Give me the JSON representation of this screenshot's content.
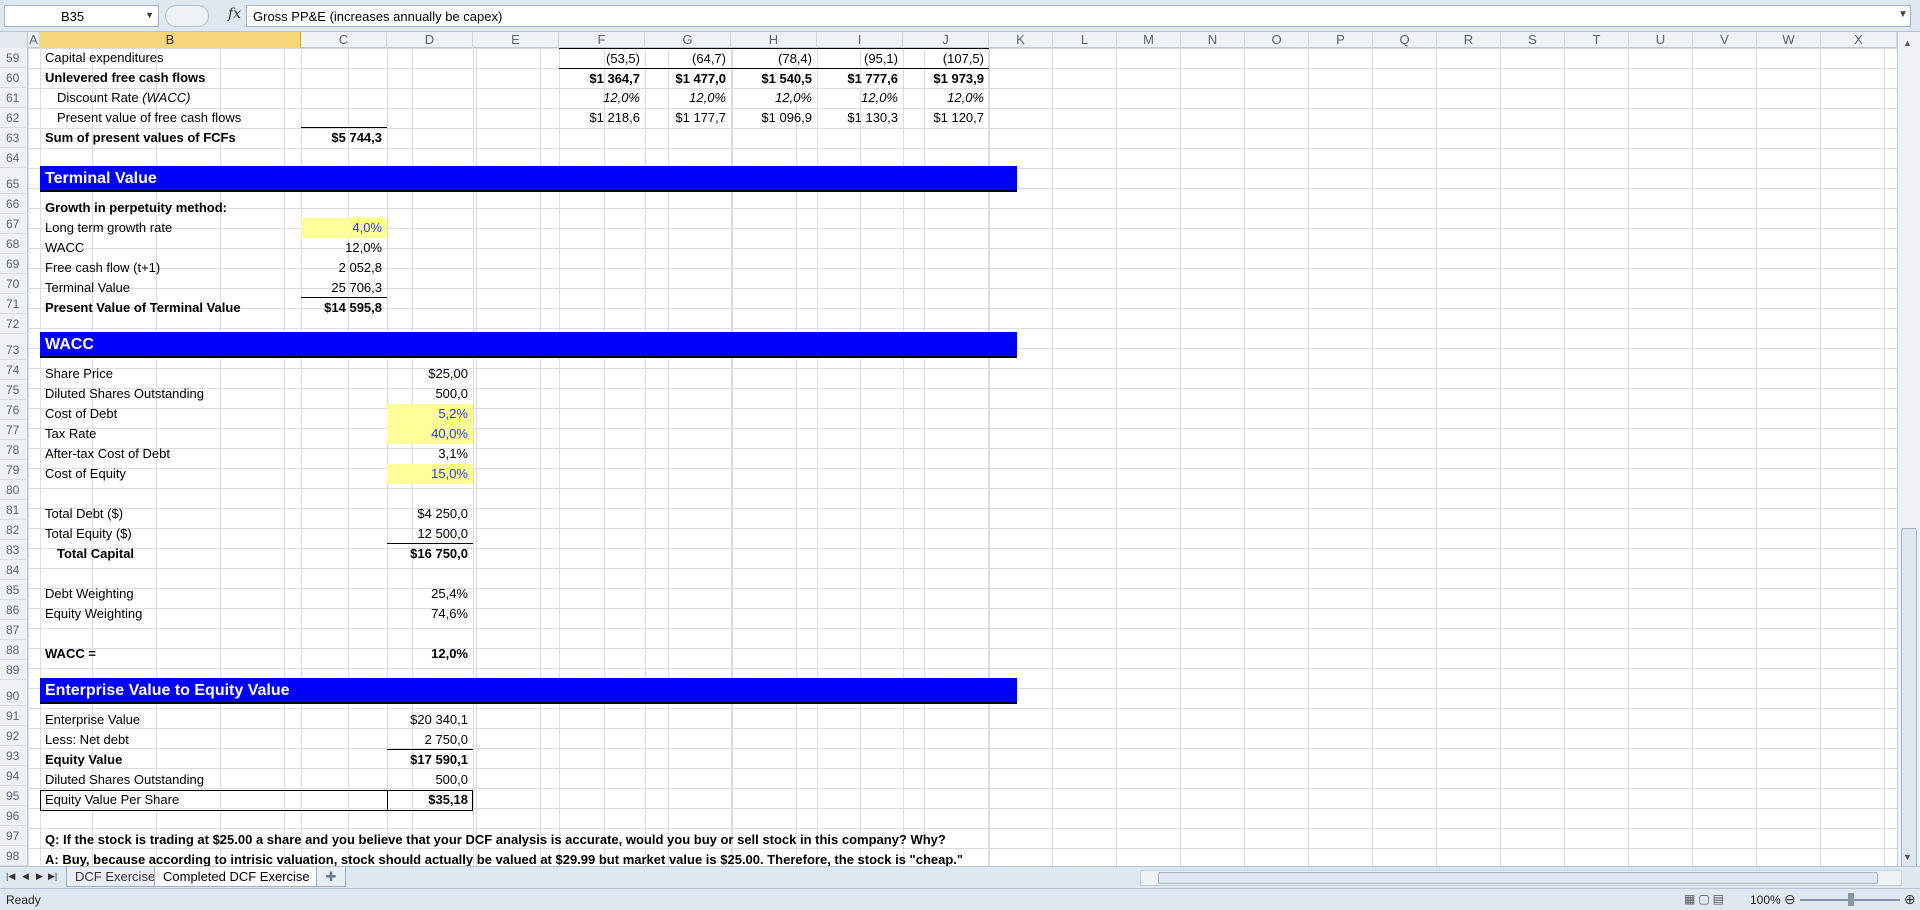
{
  "formula_bar": {
    "name_box": "B35",
    "fx_label": "fx",
    "formula": "Gross PP&E (increases annually be capex)"
  },
  "columns": [
    "A",
    "B",
    "C",
    "D",
    "E",
    "F",
    "G",
    "H",
    "I",
    "J",
    "K",
    "L",
    "M",
    "N",
    "O",
    "P",
    "Q",
    "R",
    "S",
    "T",
    "U",
    "V",
    "W",
    "X"
  ],
  "rows": [
    "59",
    "60",
    "61",
    "62",
    "63",
    "64",
    "65",
    "66",
    "67",
    "68",
    "69",
    "70",
    "71",
    "72",
    "73",
    "74",
    "75",
    "76",
    "77",
    "78",
    "79",
    "80",
    "81",
    "82",
    "83",
    "84",
    "85",
    "86",
    "87",
    "88",
    "89",
    "90",
    "91",
    "92",
    "93",
    "94",
    "95",
    "96",
    "97",
    "98"
  ],
  "fcf": {
    "capex_label": "Capital expenditures",
    "capex": [
      "(53,5)",
      "(64,7)",
      "(78,4)",
      "(95,1)",
      "(107,5)"
    ],
    "ufcf_label": "Unlevered free cash flows",
    "ufcf": [
      "$1 364,7",
      "$1 477,0",
      "$1 540,5",
      "$1 777,6",
      "$1 973,9"
    ],
    "discount_label": "Discount Rate",
    "discount_label_paren": "(WACC)",
    "discount": [
      "12,0%",
      "12,0%",
      "12,0%",
      "12,0%",
      "12,0%"
    ],
    "pv_label": "Present value of free cash flows",
    "pv": [
      "$1 218,6",
      "$1 177,7",
      "$1 096,9",
      "$1 130,3",
      "$1 120,7"
    ],
    "sum_label": "Sum of present values of FCFs",
    "sum_value": "$5 744,3"
  },
  "terminal": {
    "title": "Terminal Value",
    "method_label": "Growth in perpetuity method:",
    "ltg_label": "Long term growth rate",
    "ltg": "4,0%",
    "wacc_label": "WACC",
    "wacc": "12,0%",
    "fcf_label": "Free cash flow (t+1)",
    "fcf": "2 052,8",
    "tv_label": "Terminal Value",
    "tv": "25 706,3",
    "pvtv_label": "Present Value of Terminal Value",
    "pvtv": "$14 595,8"
  },
  "wacc": {
    "title": "WACC",
    "share_price_label": "Share Price",
    "share_price": "$25,00",
    "shares_label": "Diluted Shares Outstanding",
    "shares": "500,0",
    "cost_debt_label": "Cost of Debt",
    "cost_debt": "5,2%",
    "tax_label": "Tax Rate",
    "tax": "40,0%",
    "after_tax_label": "After-tax Cost of Debt",
    "after_tax": "3,1%",
    "cost_equity_label": "Cost of Equity",
    "cost_equity": "15,0%",
    "total_debt_label": "Total Debt ($)",
    "total_debt": "$4 250,0",
    "total_equity_label": "Total Equity ($)",
    "total_equity": "12 500,0",
    "total_capital_label": "Total Capital",
    "total_capital": "$16 750,0",
    "debt_w_label": "Debt Weighting",
    "debt_w": "25,4%",
    "equity_w_label": "Equity Weighting",
    "equity_w": "74,6%",
    "wacc_label": "WACC =",
    "wacc_value": "12,0%"
  },
  "ev": {
    "title": "Enterprise Value to Equity Value",
    "ev_label": "Enterprise Value",
    "ev": "$20 340,1",
    "net_debt_label": "Less: Net debt",
    "net_debt": "2 750,0",
    "equity_label": "Equity Value",
    "equity": "$17 590,1",
    "shares_label": "Diluted Shares Outstanding",
    "shares": "500,0",
    "per_share_label": "Equity Value Per Share",
    "per_share": "$35,18"
  },
  "qa": {
    "question": "Q: If the stock is trading at $25.00 a share and you believe that your DCF analysis is accurate, would you buy or sell stock in this company?  Why?",
    "answer": "A: Buy, because according to intrisic valuation, stock should actually be valued at $29.99 but market value is $25.00.  Therefore, the stock is \"cheap.\""
  },
  "sheets": {
    "tab1": "DCF Exercise",
    "tab2": "Completed DCF Exercise"
  },
  "status": {
    "ready": "Ready",
    "zoom": "100%"
  },
  "colors": {
    "band": "#0000ff",
    "input_fill": "#ffff99",
    "input_text": "#1f3fd6"
  }
}
